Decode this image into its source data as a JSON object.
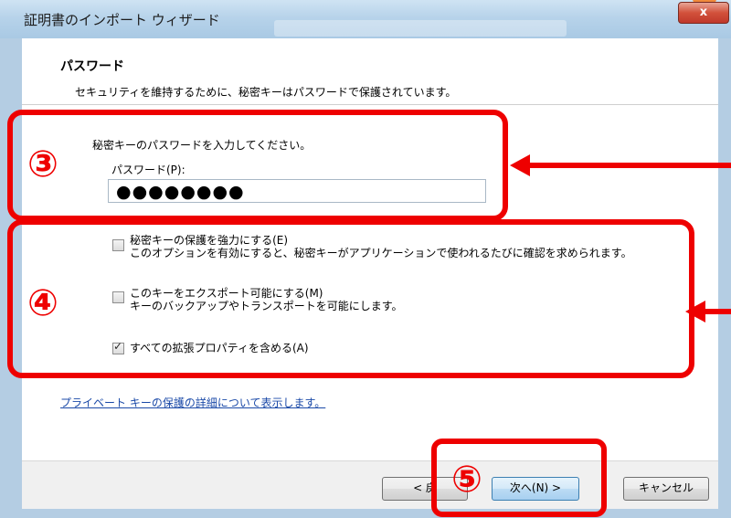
{
  "window": {
    "title": "証明書のインポート ウィザード",
    "close_label": "x"
  },
  "page": {
    "heading": "パスワード",
    "subheading": "セキュリティを維持するために、秘密キーはパスワードで保護されています。"
  },
  "password": {
    "prompt": "秘密キーのパスワードを入力してください。",
    "label": "パスワード(P):",
    "masked_value": "●●●●●●●●"
  },
  "options": [
    {
      "label": "秘密キーの保護を強力にする(E)",
      "description": "このオプションを有効にすると、秘密キーがアプリケーションで使われるたびに確認を求められます。",
      "checked": false
    },
    {
      "label": "このキーをエクスポート可能にする(M)",
      "description": "キーのバックアップやトランスポートを可能にします。",
      "checked": false
    },
    {
      "label": "すべての拡張プロパティを含める(A)",
      "checked": true
    }
  ],
  "link": {
    "text": "プライベート キーの保護の詳細について表示します。"
  },
  "buttons": {
    "back": "< 戻",
    "next": "次へ(N) >",
    "cancel": "キャンセル"
  },
  "annotations": {
    "step3": "③",
    "step4": "④",
    "step5": "⑤",
    "color": "#ee0000"
  }
}
